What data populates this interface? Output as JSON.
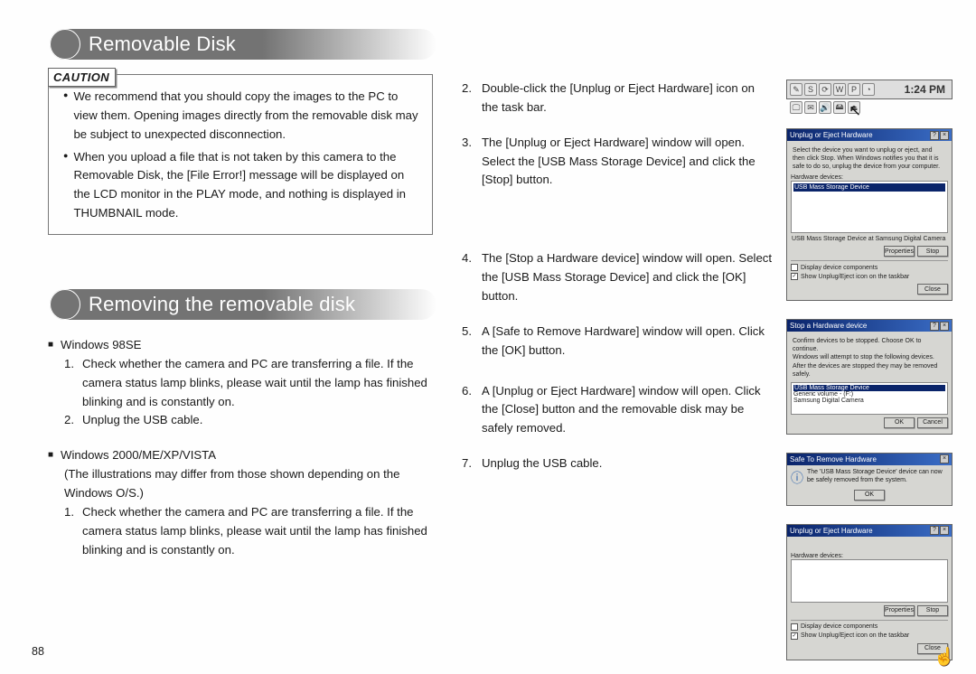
{
  "page_number": "88",
  "heading1": "Removable Disk",
  "heading2": "Removing the removable disk",
  "caution": {
    "label": "CAUTION",
    "items": [
      "We recommend that you should copy the images to the PC to view them.\nOpening images directly from the removable disk may be subject to unexpected disconnection.",
      "When you upload a file that is not taken by this camera to the Removable Disk, the [File Error!] message will be displayed on the LCD monitor in the PLAY mode, and nothing is displayed in THUMBNAIL mode."
    ]
  },
  "section2": {
    "groups": [
      {
        "title": "Windows 98SE",
        "note": "",
        "steps": [
          "Check whether the camera and PC are transferring a file. If the camera status lamp blinks, please wait until the lamp has finished blinking and is constantly on.",
          "Unplug the USB cable."
        ]
      },
      {
        "title": "Windows 2000/ME/XP/VISTA",
        "note": "(The illustrations may differ from those shown depending on the Windows O/S.)",
        "steps": [
          "Check whether the camera and PC are transferring a file. If the camera status lamp blinks, please wait until the lamp has finished blinking and is constantly on."
        ]
      }
    ]
  },
  "right_steps": [
    {
      "n": "2.",
      "t": "Double-click the [Unplug or Eject Hardware] icon on the task bar."
    },
    {
      "n": "3.",
      "t": "The [Unplug or Eject Hardware] window will open. Select the [USB Mass Storage Device] and click the [Stop] button."
    },
    {
      "n": "4.",
      "t": "The [Stop a Hardware device] window will open. Select the [USB Mass Storage Device] and click the [OK] button."
    },
    {
      "n": "5.",
      "t": "A [Safe to Remove Hardware] window will open. Click the [OK] button."
    },
    {
      "n": "6.",
      "t": "A [Unplug or Eject Hardware] window will open. Click the [Close] button and the removable disk may be safely removed."
    },
    {
      "n": "7.",
      "t": "Unplug the USB cable."
    }
  ],
  "fig_taskbar": {
    "time": "1:24 PM"
  },
  "fig_unplug": {
    "title": "Unplug or Eject Hardware",
    "instr": "Select the device you want to unplug or eject, and then click Stop. When Windows notifies you that it is safe to do so, unplug the device from your computer.",
    "hw_label": "Hardware devices:",
    "item": "USB Mass Storage Device",
    "status": "USB Mass Storage Device at Samsung Digital Camera",
    "btn_props": "Properties",
    "btn_stop": "Stop",
    "chk1": "Display device components",
    "chk2": "Show Unplug/Eject icon on the taskbar",
    "btn_close": "Close"
  },
  "fig_stop": {
    "title": "Stop a Hardware device",
    "txt": "Confirm devices to be stopped. Choose OK to continue.\nWindows will attempt to stop the following devices. After the devices are stopped they may be removed safely.",
    "items": [
      "USB Mass Storage Device",
      "Generic volume - (F:)",
      "Samsung Digital Camera"
    ],
    "btn_ok": "OK",
    "btn_cancel": "Cancel"
  },
  "fig_safe": {
    "title": "Safe To Remove Hardware",
    "txt": "The 'USB Mass Storage Device' device can now be safely removed from the system.",
    "btn_ok": "OK"
  },
  "fig_last": {
    "title": "Unplug or Eject Hardware",
    "hw_label": "Hardware devices:",
    "btn_props": "Properties",
    "btn_stop": "Stop",
    "chk1": "Display device components",
    "chk2": "Show Unplug/Eject icon on the taskbar",
    "btn_close": "Close"
  }
}
